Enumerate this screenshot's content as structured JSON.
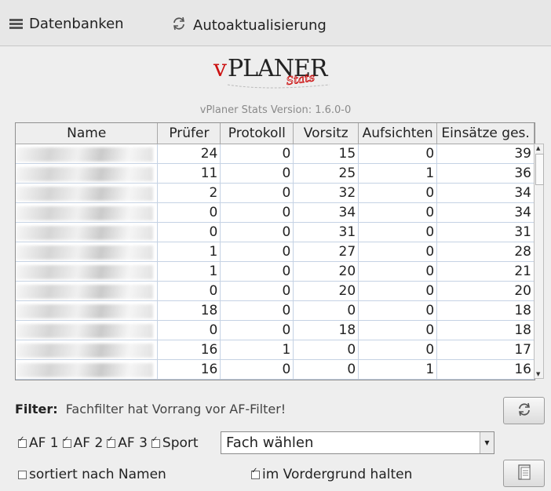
{
  "toolbar": {
    "databases_label": "Datenbanken",
    "autoupdate_label": "Autoaktualisierung"
  },
  "logo": {
    "text_v": "v",
    "text_planer": "PLANER",
    "text_stats": "Stats"
  },
  "version": "vPlaner Stats Version: 1.6.0-0",
  "table": {
    "columns": [
      "Name",
      "Prüfer",
      "Protokoll",
      "Vorsitz",
      "Aufsichten",
      "Einsätze ges."
    ],
    "rows": [
      [
        "24",
        "0",
        "15",
        "0",
        "39"
      ],
      [
        "11",
        "0",
        "25",
        "1",
        "36"
      ],
      [
        "2",
        "0",
        "32",
        "0",
        "34"
      ],
      [
        "0",
        "0",
        "34",
        "0",
        "34"
      ],
      [
        "0",
        "0",
        "31",
        "0",
        "31"
      ],
      [
        "1",
        "0",
        "27",
        "0",
        "28"
      ],
      [
        "1",
        "0",
        "20",
        "0",
        "21"
      ],
      [
        "0",
        "0",
        "20",
        "0",
        "20"
      ],
      [
        "18",
        "0",
        "0",
        "0",
        "18"
      ],
      [
        "0",
        "0",
        "18",
        "0",
        "18"
      ],
      [
        "16",
        "1",
        "0",
        "0",
        "17"
      ],
      [
        "16",
        "0",
        "0",
        "1",
        "16"
      ]
    ]
  },
  "filter": {
    "label": "Filter:",
    "hint": "Fachfilter hat Vorrang vor AF-Filter!",
    "af1": "AF 1",
    "af2": "AF 2",
    "af3": "AF 3",
    "sport": "Sport",
    "subject_select": "Fach wählen",
    "sort_by_name": "sortiert nach Namen",
    "keep_foreground": "im Vordergrund halten"
  },
  "icons": {
    "databases": "database-list-icon",
    "autoupdate": "refresh-icon",
    "refresh_button": "refresh-icon",
    "export_button": "document-icon"
  }
}
